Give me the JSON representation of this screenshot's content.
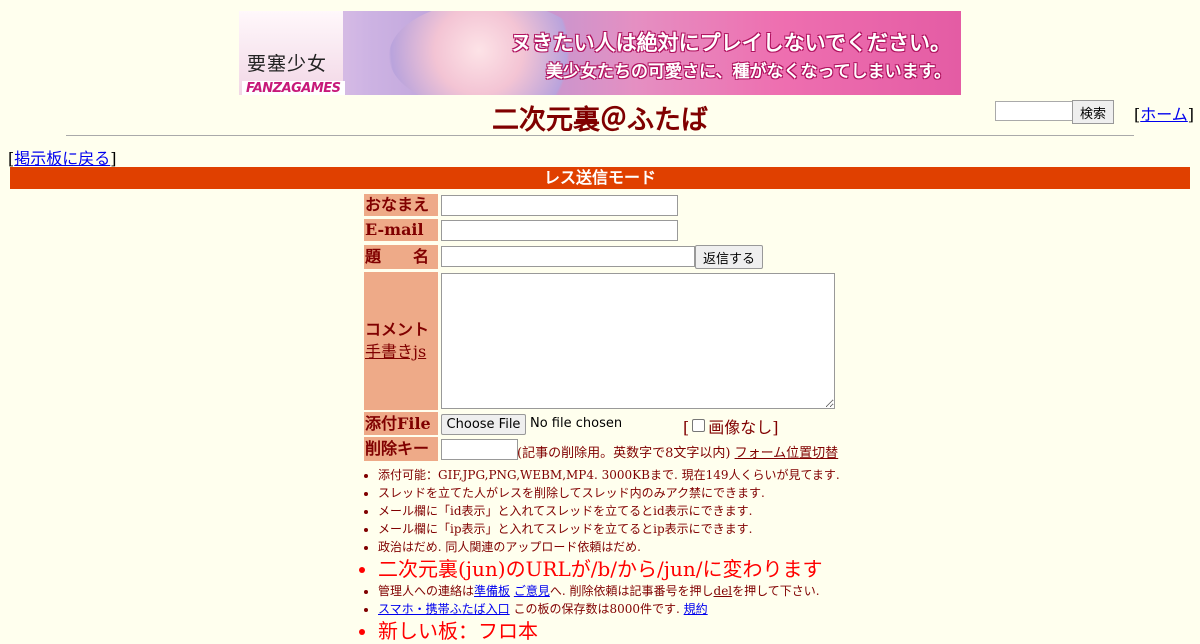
{
  "banner": {
    "game_logo": "要塞少女",
    "brand": "FANZAGAMES",
    "copy_line1": "ヌきたい人は絶対にプレイしないでください。",
    "copy_line2": "美少女たちの可愛さに、種がなくなってしまいます。"
  },
  "header": {
    "search_button": "検索",
    "search_value": "",
    "home_open": "[",
    "home_label": "ホーム",
    "home_close": "]",
    "title": "二次元裏＠ふたば"
  },
  "nav": {
    "back_open": "[",
    "back_label": "掲示板に戻る",
    "back_close": "]"
  },
  "mode_label": "レス送信モード",
  "form": {
    "name_label": "おなまえ",
    "email_label": "E-mail",
    "subject_label": "題　　名",
    "submit_button": "返信する",
    "comment_label": "コメント",
    "handwrite_link": "手書きjs",
    "file_label": "添付File",
    "choose_file_button": "Choose File",
    "file_status": "No file chosen",
    "noimage_open": "[",
    "noimage_label": "画像なし",
    "noimage_close": "]",
    "delkey_label": "削除キー",
    "delkey_note": "(記事の削除用。英数字で8文字以内)",
    "form_toggle_link": "フォーム位置切替"
  },
  "rules": {
    "r1": "添付可能：GIF,JPG,PNG,WEBM,MP4. 3000KBまで. 現在149人くらいが見てます.",
    "r2": "スレッドを立てた人がレスを削除してスレッド内のみアク禁にできます.",
    "r3": "メール欄に「id表示」と入れてスレッドを立てるとid表示にできます.",
    "r4": "メール欄に「ip表示」と入れてスレッドを立てるとip表示にできます.",
    "r5": "政治はだめ. 同人関連のアップロード依頼はだめ.",
    "announce": "二次元裏(jun)のURLが/b/から/jun/に変わります",
    "r7_pre": "管理人への連絡は",
    "r7_link1": "準備板",
    "r7_link2": "ご意見",
    "r7_mid": "へ. 削除依頼は記事番号を押し",
    "r7_del": "del",
    "r7_post": "を押して下さい.",
    "r8_link": "スマホ・携帯ふたば入口",
    "r8_text": " この板の保存数は8000件です.",
    "r8_rules_link": "規約",
    "r9": "新しい板：フロ本"
  }
}
